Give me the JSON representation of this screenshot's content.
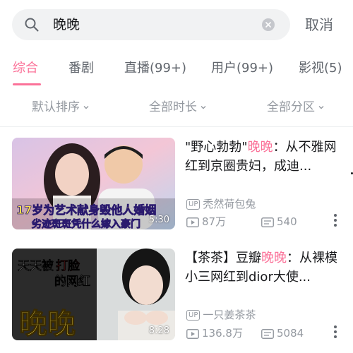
{
  "search": {
    "query": "晚晚",
    "cancel_label": "取消"
  },
  "tabs": [
    {
      "label": "综合",
      "active": true
    },
    {
      "label": "番剧",
      "active": false
    },
    {
      "label": "直播(99+)",
      "active": false
    },
    {
      "label": "用户(99+)",
      "active": false
    },
    {
      "label": "影视(5)",
      "active": false
    }
  ],
  "filters": [
    {
      "label": "默认排序"
    },
    {
      "label": "全部时长"
    },
    {
      "label": "全部分区"
    }
  ],
  "videos": [
    {
      "title_before": "\"野心勃勃\"",
      "title_highlight": "晚晚",
      "title_after": "：从不雅网红到京圈贵妇，成迪...",
      "thumb_caption_line1": "17岁为艺术献身毁他人婚姻",
      "thumb_caption_line2": "劣迹斑斑凭什么嫁入豪门",
      "duration": "5:30",
      "up_badge": "UP",
      "uploader": "秃然荷包兔",
      "views": "87万",
      "comments": "540"
    },
    {
      "title_before": "【茶茶】豆瓣",
      "title_highlight": "晚晚",
      "title_after": "：从裸模小三网红到dior大使...",
      "thumb_caption_line1": "天天被",
      "thumb_caption_line1b": "打脸",
      "thumb_caption_line2": "的网红",
      "thumb_caption_big": "晚晚",
      "duration": "8:28",
      "up_badge": "UP",
      "uploader": "一只姜茶茶",
      "views": "136.8万",
      "comments": "5084"
    }
  ],
  "colors": {
    "accent": "#fb7299",
    "text_secondary": "#9499a0",
    "search_bg": "#f1f2f3"
  }
}
